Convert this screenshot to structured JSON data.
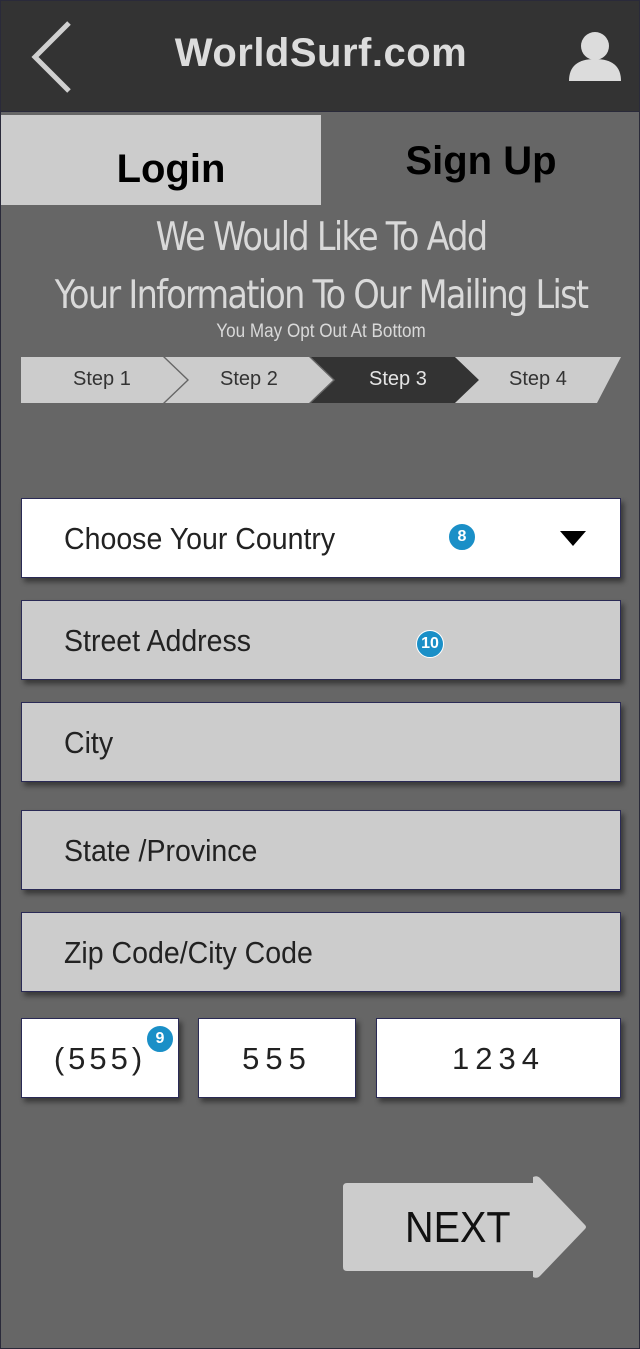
{
  "header": {
    "title": "WorldSurf.com",
    "back_icon": "chevron-left-icon",
    "user_icon": "user-icon"
  },
  "tabs": [
    {
      "label": "Login",
      "active": false
    },
    {
      "label": "Sign Up",
      "active": true
    }
  ],
  "intro": {
    "line1": "We Would Like To Add",
    "line2": "Your Information To Our Mailing List",
    "note": "You May Opt Out At Bottom"
  },
  "steps": [
    {
      "label": "Step 1",
      "active": false
    },
    {
      "label": "Step 2",
      "active": false
    },
    {
      "label": "Step 3",
      "active": true
    },
    {
      "label": "Step 4",
      "active": false
    }
  ],
  "form": {
    "country": {
      "placeholder": "Choose Your Country",
      "badge": "8"
    },
    "street": {
      "placeholder": "Street Address",
      "badge": "10"
    },
    "city": {
      "placeholder": "City"
    },
    "state": {
      "placeholder": "State /Province"
    },
    "zip": {
      "placeholder": "Zip Code/City Code"
    },
    "phone": {
      "area": "(555)",
      "prefix": "555",
      "line": "1234",
      "badge": "9"
    }
  },
  "next_label": "NEXT",
  "colors": {
    "background": "#666666",
    "topbar": "#333333",
    "field": "#cccccc",
    "active_step": "#333333",
    "badge": "#1a8fc7"
  }
}
